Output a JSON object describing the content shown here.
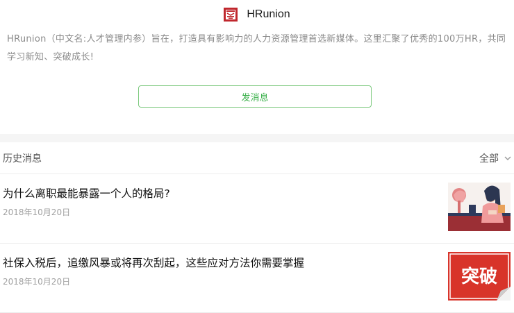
{
  "profile": {
    "name": "HRunion",
    "intro": "HRunion（中文名:人才管理内参）旨在，打造具有影响力的人力资源管理首选新媒体。这里汇聚了优秀的100万HR，共同学习新知、突破成长!",
    "send_message_label": "发消息"
  },
  "history": {
    "title": "历史消息",
    "filter_label": "全部"
  },
  "articles": [
    {
      "title": "为什么离职最能暴露一个人的格局?",
      "date": "2018年10月20日",
      "thumbnail_icon": "illustration-woman-at-desk"
    },
    {
      "title": "社保入税后，追缴风暴或将再次刮起，这些应对方法你需要掌握",
      "date": "2018年10月20日",
      "thumbnail_icon": "breakthrough-red-sign",
      "thumbnail_text": "突破"
    }
  ],
  "colors": {
    "brand_red": "#c0272d",
    "button_green": "#3ab04a",
    "button_border": "#7cc97e"
  }
}
